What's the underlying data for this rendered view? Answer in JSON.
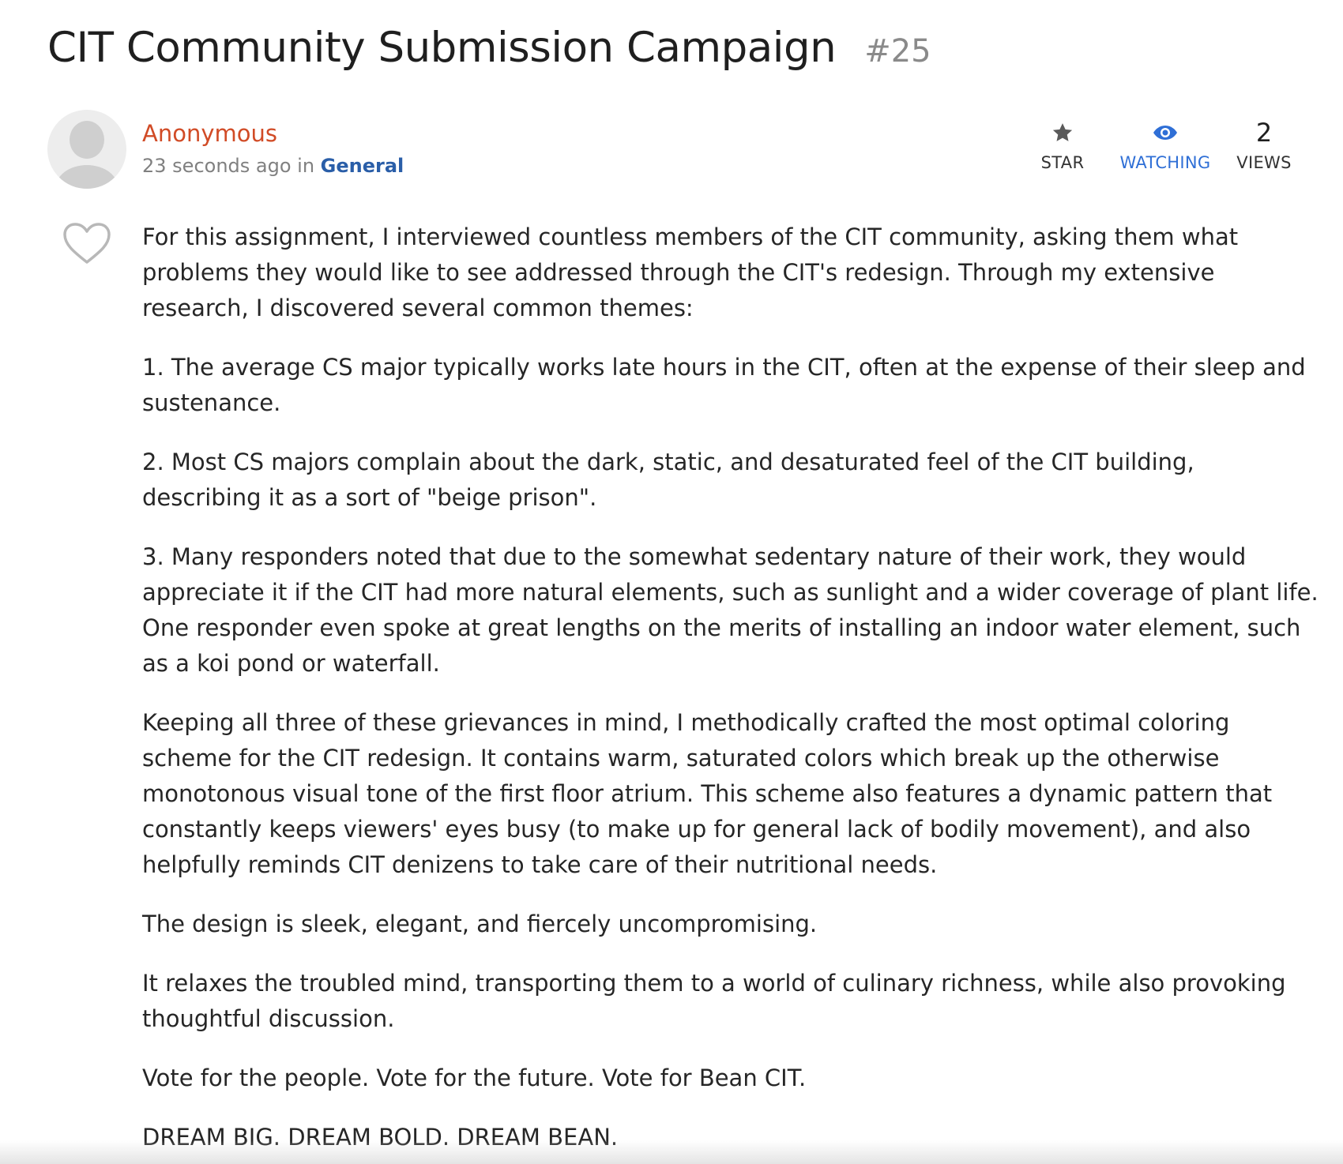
{
  "post": {
    "title": "CIT Community Submission Campaign",
    "number": "#25",
    "author": "Anonymous",
    "time": "23 seconds ago",
    "in_word": " in ",
    "category": "General"
  },
  "stats": {
    "star_label": "STAR",
    "watching_label": "WATCHING",
    "views_count": "2",
    "views_label": "VIEWS"
  },
  "icons": {
    "star": "star-icon",
    "watch": "eye-icon",
    "like": "heart-icon",
    "avatar": "user-avatar-icon"
  },
  "colors": {
    "author": "#d14b26",
    "category": "#2a5ea8",
    "watching": "#2f6fd6",
    "text": "#262626",
    "muted": "#808080"
  },
  "body": {
    "paragraphs": [
      "For this assignment, I interviewed countless members of the CIT community, asking them what problems they would like to see addressed through the CIT's redesign. Through my extensive research, I discovered several common themes:",
      "1. The average CS major typically works late hours in the CIT, often at the expense of their sleep and sustenance.",
      "2. Most CS majors complain about the dark, static, and desaturated feel of the CIT building, describing it as a sort of \"beige prison\".",
      "3. Many responders noted that due to the somewhat sedentary nature of their work, they would appreciate it if the CIT had more natural elements, such as sunlight and a wider coverage of plant life. One responder even spoke at great lengths on the merits of installing an indoor water element, such as a koi pond or waterfall.",
      "Keeping all three of these grievances in mind, I methodically crafted the most optimal coloring scheme for the CIT redesign. It contains warm, saturated colors which break up the otherwise monotonous visual tone of the first floor atrium. This scheme also features a dynamic pattern that constantly keeps viewers' eyes busy (to make up for general lack of bodily movement), and also helpfully reminds CIT denizens to take care of their nutritional needs.",
      "The design is sleek, elegant, and fiercely uncompromising.",
      "It relaxes the troubled mind, transporting them to a world of culinary richness, while also provoking thoughtful discussion.",
      "Vote for the people. Vote for the future. Vote for Bean CIT.",
      "DREAM BIG. DREAM BOLD. DREAM BEAN."
    ]
  }
}
